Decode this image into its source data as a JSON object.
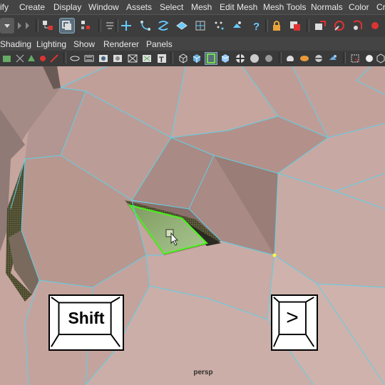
{
  "menubar": {
    "items": [
      "ify",
      "Create",
      "Display",
      "Window",
      "Assets",
      "Select",
      "Mesh",
      "Edit Mesh",
      "Mesh Tools",
      "Normals",
      "Color",
      "Cr"
    ]
  },
  "panel_menu": {
    "items": [
      "Shading",
      "Lighting",
      "Show",
      "Renderer",
      "Panels"
    ]
  },
  "viewport": {
    "camera_label": "persp",
    "wire_color": "#5fd0e8",
    "selection_color": "#7dff3a",
    "surface_color": "#c9aaa4"
  },
  "keys": {
    "shift_label": "Shift",
    "next_label": ">"
  },
  "toolbar_icons": [
    "mode-dropdown-icon",
    "select-by-hierarchy-icon",
    "select-by-object-icon",
    "select-by-component-icon",
    "snap-grid-icon",
    "snap-curve-icon",
    "snap-point-icon",
    "snap-plane-icon",
    "snap-live-icon",
    "snap-view-icon",
    "make-live-icon",
    "history-icon",
    "lock-icon",
    "construction-history-icon",
    "render-icon",
    "ipr-render-icon",
    "render-settings-icon"
  ]
}
